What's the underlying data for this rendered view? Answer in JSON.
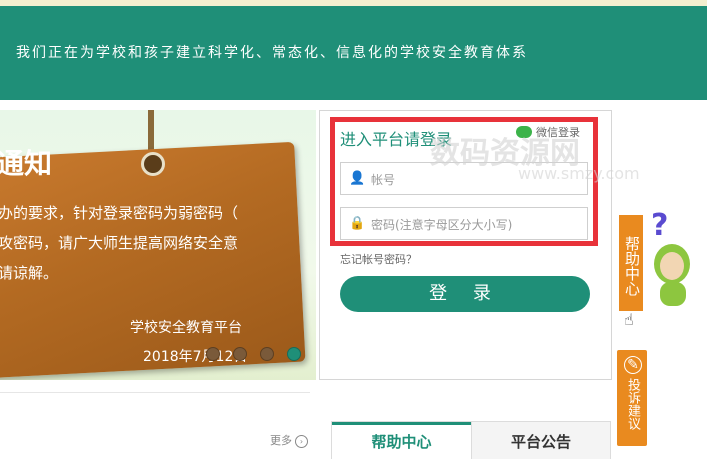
{
  "header": {
    "slogan": "我们正在为学校和孩子建立科学化、常态化、信息化的学校安全教育体系"
  },
  "banner": {
    "title": "通知",
    "lines": [
      "办的要求，针对登录密码为弱密码（",
      "攻密码，请广大师生提高网络安全意",
      "请谅解。"
    ],
    "signature": "学校安全教育平台",
    "date": "2018年7月12日",
    "carousel_count": 4,
    "carousel_active_index": 3
  },
  "login": {
    "title": "进入平台请登录",
    "wechat_label": "微信登录",
    "username_placeholder": "帐号",
    "password_placeholder": "密码(注意字母区分大小写)",
    "forgot_label": "忘记帐号密码？",
    "submit_label": "登 录"
  },
  "watermark": {
    "text": "数码资源网",
    "url": "www.smzy.com"
  },
  "side": {
    "help_label": "帮助中心",
    "question_mark": "?",
    "suggest_label": "投诉建议"
  },
  "lower": {
    "more_label": "更多",
    "tabs": [
      {
        "label": "帮助中心",
        "active": true
      },
      {
        "label": "平台公告",
        "active": false
      }
    ]
  },
  "colors": {
    "brand_green": "#1f8f78",
    "highlight_red": "#e8323a",
    "side_orange": "#e98a1f"
  }
}
